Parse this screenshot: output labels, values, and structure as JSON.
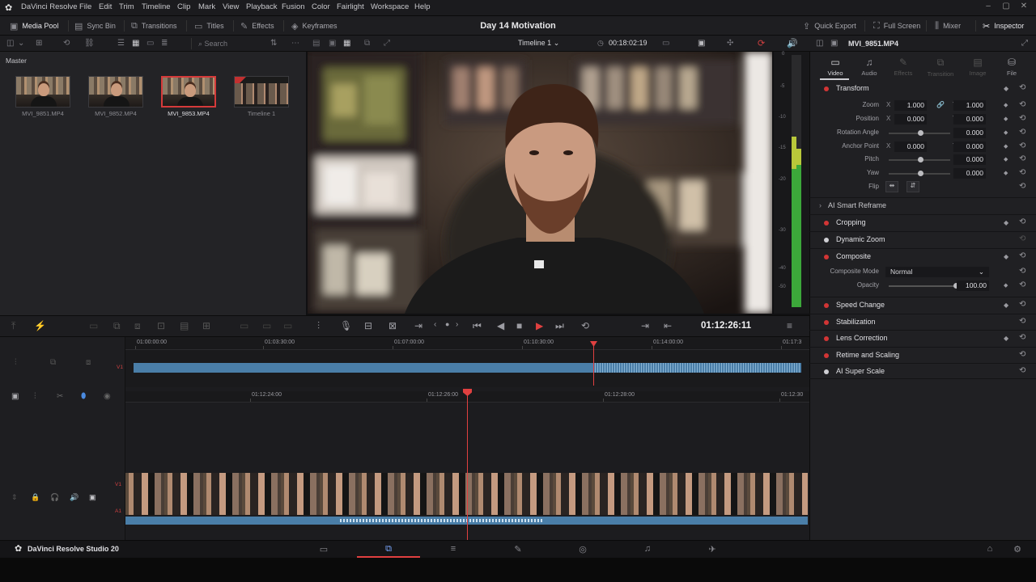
{
  "app": {
    "name": "DaVinci Resolve",
    "studio_label": "DaVinci Resolve Studio 20"
  },
  "menu": [
    "File",
    "Edit",
    "Trim",
    "Timeline",
    "Clip",
    "Mark",
    "View",
    "Playback",
    "Fusion",
    "Color",
    "Fairlight",
    "Workspace",
    "Help"
  ],
  "toolbar": {
    "left": [
      "Media Pool",
      "Sync Bin",
      "Transitions",
      "Titles",
      "Effects",
      "Keyframes"
    ],
    "project_title": "Day 14 Motivation",
    "right": [
      "Quick Export",
      "Full Screen",
      "Mixer",
      "Inspector"
    ]
  },
  "media_pool": {
    "search_placeholder": "Search",
    "bin": "Master",
    "clips": [
      {
        "name": "MVI_9851.MP4",
        "selected": false
      },
      {
        "name": "MVI_9852.MP4",
        "selected": false
      },
      {
        "name": "MVI_9853.MP4",
        "selected": true
      },
      {
        "name": "Timeline 1",
        "selected": false
      }
    ]
  },
  "viewer": {
    "timeline_name": "Timeline 1",
    "duration_tc": "00:18:02:19",
    "playhead_tc": "01:12:26:11"
  },
  "meters": {
    "scale": [
      "0",
      "-5",
      "-10",
      "-15",
      "-20",
      "-30",
      "-40",
      "-50"
    ],
    "level_fraction": 0.55
  },
  "inspector": {
    "clip_name": "MVI_9851.MP4",
    "tabs": [
      {
        "label": "Video",
        "active": true
      },
      {
        "label": "Audio",
        "active": false
      },
      {
        "label": "Effects",
        "active": false
      },
      {
        "label": "Transition",
        "active": false
      },
      {
        "label": "Image",
        "active": false
      },
      {
        "label": "File",
        "active": false
      }
    ],
    "transform": {
      "label": "Transform",
      "zoom": {
        "label": "Zoom",
        "x": "1.000",
        "y": "1.000"
      },
      "position": {
        "label": "Position",
        "x": "0.000",
        "y": "0.000"
      },
      "rotation": {
        "label": "Rotation Angle",
        "value": "0.000"
      },
      "anchor": {
        "label": "Anchor Point",
        "x": "0.000",
        "y": "0.000"
      },
      "pitch": {
        "label": "Pitch",
        "value": "0.000"
      },
      "yaw": {
        "label": "Yaw",
        "value": "0.000"
      },
      "flip": {
        "label": "Flip"
      }
    },
    "ai_smart_reframe": "AI Smart Reframe",
    "cropping": "Cropping",
    "dynamic_zoom": "Dynamic Zoom",
    "composite": {
      "label": "Composite",
      "mode_label": "Composite Mode",
      "mode_value": "Normal",
      "opacity_label": "Opacity",
      "opacity_value": "100.00"
    },
    "sections": [
      "Speed Change",
      "Stabilization",
      "Lens Correction",
      "Retime and Scaling",
      "AI Super Scale"
    ]
  },
  "timeline": {
    "upper_ruler": [
      "01:00:00:00",
      "01:03:30:00",
      "01:07:00:00",
      "01:10:30:00",
      "01:14:00:00",
      "01:17:3"
    ],
    "lower_ruler": [
      "01:12:24:00",
      "01:12:26:00",
      "01:12:28:00",
      "01:12:30"
    ],
    "v1_label": "V1",
    "a1_label": "A1"
  },
  "axis_labels": {
    "x": "X",
    "y": "Y"
  }
}
